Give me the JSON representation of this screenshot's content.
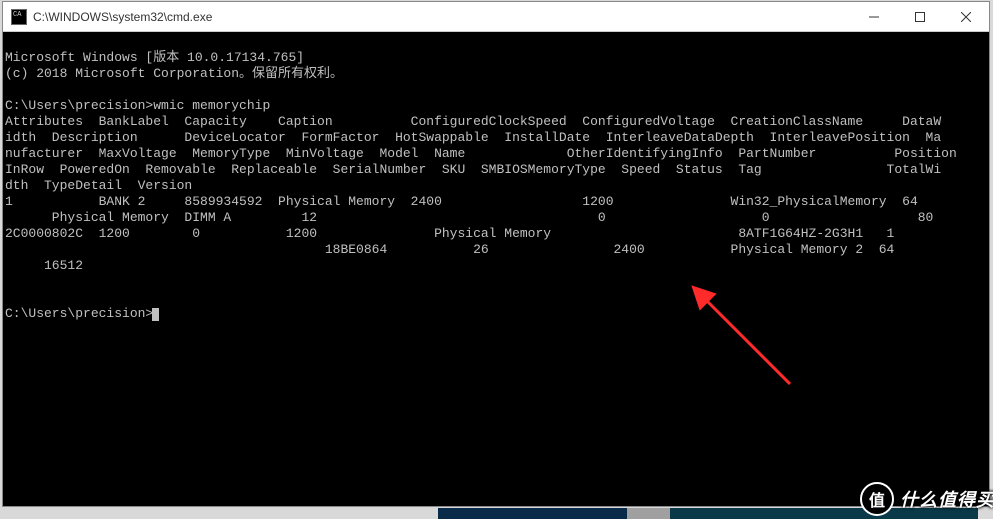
{
  "window": {
    "title": "C:\\WINDOWS\\system32\\cmd.exe"
  },
  "terminal": {
    "lines": [
      "Microsoft Windows [版本 10.0.17134.765]",
      "(c) 2018 Microsoft Corporation。保留所有权利。",
      "",
      "C:\\Users\\precision>wmic memorychip",
      "Attributes  BankLabel  Capacity    Caption          ConfiguredClockSpeed  ConfiguredVoltage  CreationClassName     DataW",
      "idth  Description      DeviceLocator  FormFactor  HotSwappable  InstallDate  InterleaveDataDepth  InterleavePosition  Ma",
      "nufacturer  MaxVoltage  MemoryType  MinVoltage  Model  Name             OtherIdentifyingInfo  PartNumber          Position",
      "InRow  PoweredOn  Removable  Replaceable  SerialNumber  SKU  SMBIOSMemoryType  Speed  Status  Tag                TotalWi",
      "dth  TypeDetail  Version",
      "1           BANK 2     8589934592  Physical Memory  2400                  1200               Win32_PhysicalMemory  64",
      "      Physical Memory  DIMM A         12                                    0                    0                   80",
      "2C0000802C  1200        0           1200               Physical Memory                        8ATF1G64HZ-2G3H1   1",
      "                                         18BE0864           26                2400           Physical Memory 2  64",
      "     16512",
      "",
      "",
      "C:\\Users\\precision>"
    ],
    "prompt_cursor": true
  },
  "watermark": {
    "symbol": "值",
    "text": "什么值得买"
  }
}
